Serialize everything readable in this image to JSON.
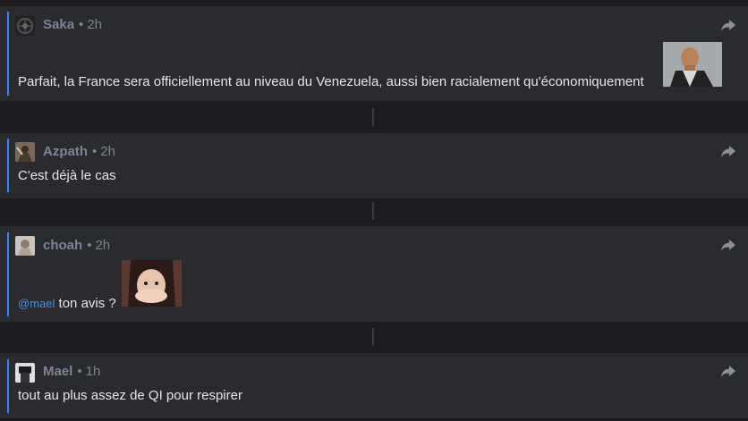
{
  "posts": [
    {
      "author": "Saka",
      "separator": "•",
      "time": "2h",
      "text": "Parfait, la France sera officiellement au niveau du Venezuela, aussi bien racialement qu'économiquement",
      "sticker": "smirking-man-sticker"
    },
    {
      "author": "Azpath",
      "separator": "•",
      "time": "2h",
      "text": "C'est déjà le cas"
    },
    {
      "author": "choah",
      "separator": "•",
      "time": "2h",
      "mention": "@mael",
      "text": "ton avis ?",
      "sticker": "covering-mouth-girl-sticker"
    },
    {
      "author": "Mael",
      "separator": "•",
      "time": "1h",
      "text": "tout au plus assez de QI pour respirer"
    }
  ],
  "icons": {
    "share": "share-arrow-icon"
  },
  "colors": {
    "thread_bar": "#3b82f6",
    "mention": "#4a90e2",
    "card_bg": "#2a2b2f",
    "page_bg": "#1b1c1f"
  }
}
